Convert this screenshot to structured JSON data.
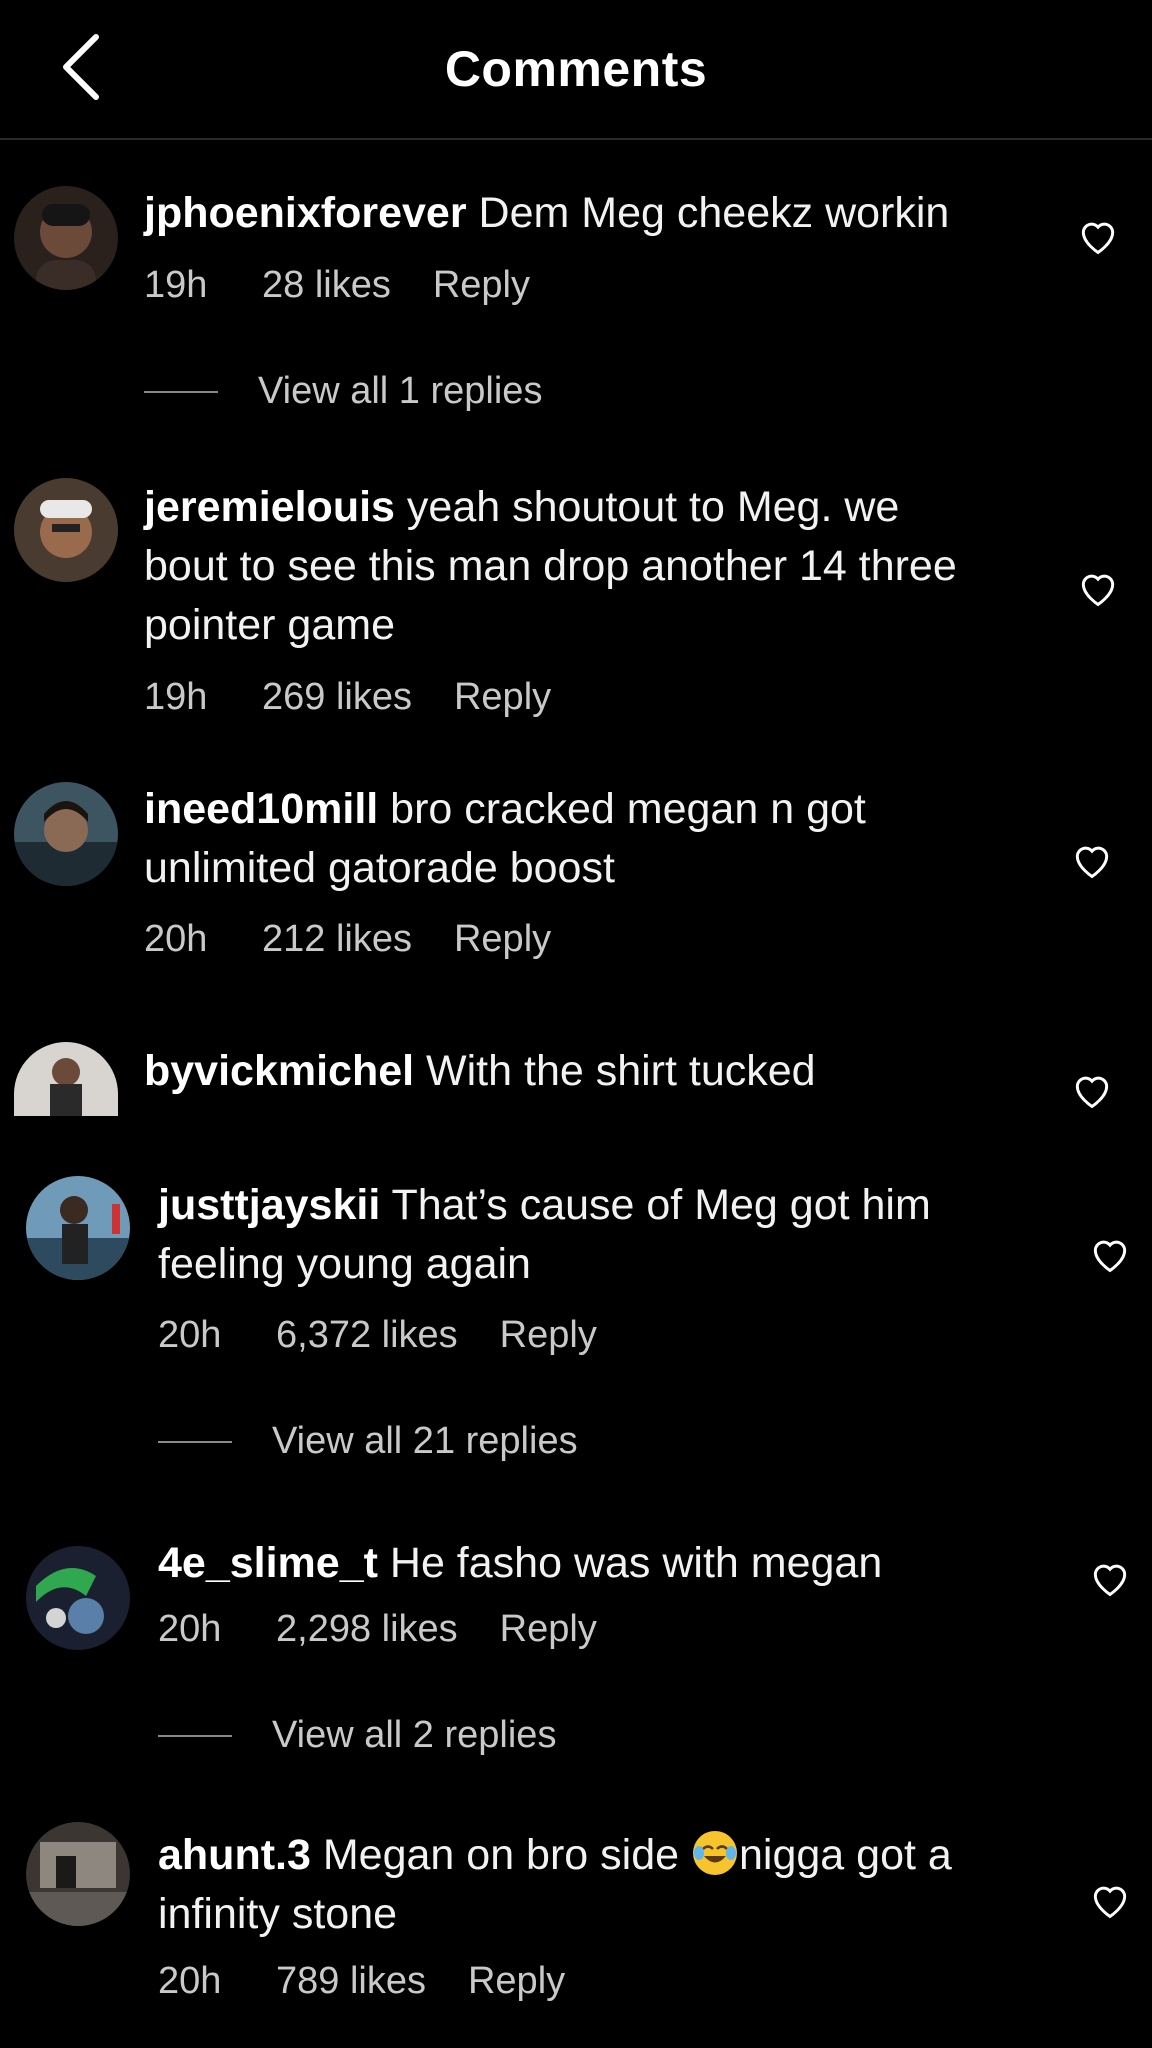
{
  "header": {
    "title": "Comments",
    "back_icon": "chevron-left-icon"
  },
  "comments": [
    {
      "username": "jphoenixforever",
      "text": "Dem Meg cheekz workin",
      "time": "19h",
      "likes": "28 likes",
      "reply": "Reply",
      "view_replies": "View all 1 replies"
    },
    {
      "username": "jeremielouis",
      "text_1": "yeah shoutout to Meg. we",
      "text_2": "bout to see this man drop another 14 three",
      "text_3": "pointer game",
      "time": "19h",
      "likes": "269 likes",
      "reply": "Reply"
    },
    {
      "username": "ineed10mill",
      "text_1": "bro cracked megan n got",
      "text_2": "unlimited gatorade boost",
      "time": "20h",
      "likes": "212 likes",
      "reply": "Reply"
    },
    {
      "username": "byvickmichel",
      "text": "With the shirt tucked"
    },
    {
      "username": "justtjayskii",
      "text_1": "That’s cause of Meg got him",
      "text_2": "feeling young again",
      "time": "20h",
      "likes": "6,372 likes",
      "reply": "Reply",
      "view_replies": "View all 21 replies"
    },
    {
      "username": "4e_slime_t",
      "text": "He fasho was with megan",
      "time": "20h",
      "likes": "2,298 likes",
      "reply": "Reply",
      "view_replies": "View all 2 replies"
    },
    {
      "username": "ahunt.3",
      "text_1a": "Megan on bro side",
      "emoji": "face-with-tears-of-joy",
      "text_1b": "nigga got a",
      "text_2": "infinity stone",
      "time": "20h",
      "likes": "789 likes",
      "reply": "Reply"
    }
  ],
  "icons": {
    "like": "heart-outline-icon"
  },
  "colors": {
    "background": "#000000",
    "text": "#ffffff",
    "secondary": "#c9c9c9"
  }
}
